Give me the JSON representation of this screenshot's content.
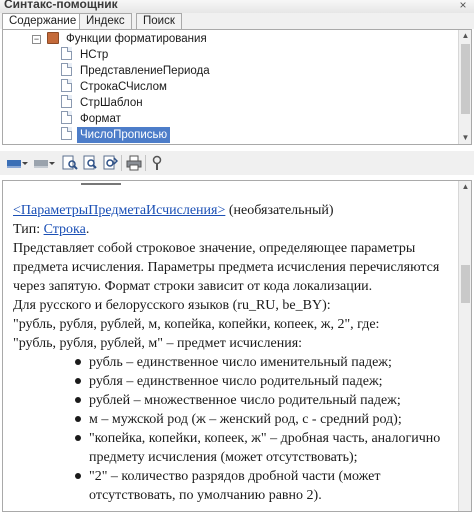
{
  "window": {
    "title": "Синтакс-помощник",
    "close_glyph": "×"
  },
  "tabs": [
    {
      "label": "Содержание",
      "active": true
    },
    {
      "label": "Индекс",
      "active": false
    },
    {
      "label": "Поиск",
      "active": false
    }
  ],
  "tree": {
    "parent": {
      "label": "Функции форматирования",
      "expander": "−"
    },
    "items": [
      {
        "label": "НСтр",
        "selected": false
      },
      {
        "label": "ПредставлениеПериода",
        "selected": false
      },
      {
        "label": "СтрокаСЧислом",
        "selected": false
      },
      {
        "label": "СтрШаблон",
        "selected": false
      },
      {
        "label": "Формат",
        "selected": false
      },
      {
        "label": "ЧислоПрописью",
        "selected": true
      }
    ]
  },
  "toolbar": {
    "icons": [
      "back-icon",
      "dropdown-icon",
      "forward-icon",
      "dropdown-icon",
      "find-in-tree-icon",
      "find-icon",
      "find-next-icon",
      "print-icon",
      "settings-icon"
    ]
  },
  "content": {
    "param_name": "<ПараметрыПредметаИсчисления>",
    "param_optional": " (необязательный)",
    "type_label": "Тип: ",
    "type_link": "Строка",
    "type_suffix": ".",
    "description": "Представляет собой строковое значение, определяющее параметры предмета исчисления. Параметры предмета исчисления перечисляются через запятую. Формат строки зависит от кода локализации.",
    "ru_be_intro": "Для русского и белорусского языков (ru_RU, be_BY):",
    "example_line": "\"рубль, рубля, рублей, м, копейка, копейки, копеек, ж, 2\", где:",
    "example_subject": "\"рубль, рубля, рублей, м\" – предмет исчисления:",
    "bullets": [
      "рубль – единственное число именительный падеж;",
      "рубля – единственное число родительный падеж;",
      "рублей – множественное число родительный падеж;",
      "м – мужской род (ж – женский род, с - средний род);",
      "\"копейка, копейки, копеек, ж\" – дробная часть, аналогично предмету исчисления (может отсутствовать);",
      "\"2\" – количество разрядов дробной части (может отсутствовать, по умолчанию равно 2)."
    ]
  }
}
